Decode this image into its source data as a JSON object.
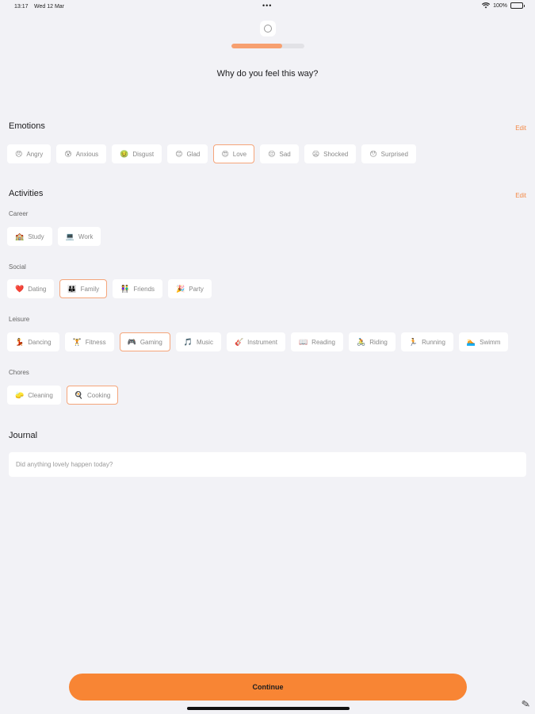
{
  "status_bar": {
    "time": "13:17",
    "date": "Wed 12 Mar",
    "battery": "100%"
  },
  "header": {
    "progress": 0.7,
    "question": "Why do you feel this way?"
  },
  "emotions": {
    "title": "Emotions",
    "edit_label": "Edit",
    "items": [
      {
        "icon": "😠",
        "label": "Angry",
        "selected": false
      },
      {
        "icon": "😰",
        "label": "Anxious",
        "selected": false
      },
      {
        "icon": "🤢",
        "label": "Disgust",
        "selected": false
      },
      {
        "icon": "😊",
        "label": "Glad",
        "selected": false
      },
      {
        "icon": "😍",
        "label": "Love",
        "selected": true
      },
      {
        "icon": "😔",
        "label": "Sad",
        "selected": false
      },
      {
        "icon": "😦",
        "label": "Shocked",
        "selected": false
      },
      {
        "icon": "😯",
        "label": "Surprised",
        "selected": false
      }
    ]
  },
  "activities": {
    "title": "Activities",
    "edit_label": "Edit",
    "groups": [
      {
        "name": "Career",
        "items": [
          {
            "icon": "🏫",
            "label": "Study",
            "selected": false
          },
          {
            "icon": "💻",
            "label": "Work",
            "selected": false
          }
        ]
      },
      {
        "name": "Social",
        "items": [
          {
            "icon": "❤️",
            "label": "Dating",
            "selected": false
          },
          {
            "icon": "👪",
            "label": "Family",
            "selected": true
          },
          {
            "icon": "👫",
            "label": "Friends",
            "selected": false
          },
          {
            "icon": "🎉",
            "label": "Party",
            "selected": false
          }
        ]
      },
      {
        "name": "Leisure",
        "items": [
          {
            "icon": "💃",
            "label": "Dancing",
            "selected": false
          },
          {
            "icon": "🏋",
            "label": "Fitness",
            "selected": false
          },
          {
            "icon": "🎮",
            "label": "Gaming",
            "selected": true
          },
          {
            "icon": "🎵",
            "label": "Music",
            "selected": false
          },
          {
            "icon": "🎸",
            "label": "Instrument",
            "selected": false
          },
          {
            "icon": "📖",
            "label": "Reading",
            "selected": false
          },
          {
            "icon": "🚴",
            "label": "Riding",
            "selected": false
          },
          {
            "icon": "🏃",
            "label": "Running",
            "selected": false
          },
          {
            "icon": "🏊",
            "label": "Swimm",
            "selected": false
          }
        ]
      },
      {
        "name": "Chores",
        "items": [
          {
            "icon": "🧽",
            "label": "Cleaning",
            "selected": false
          },
          {
            "icon": "🍳",
            "label": "Cooking",
            "selected": true
          }
        ]
      }
    ]
  },
  "journal": {
    "title": "Journal",
    "placeholder": "Did anything lovely happen today?"
  },
  "footer": {
    "continue_label": "Continue"
  },
  "colors": {
    "accent": "#f88534",
    "selected_border": "#f5a57a",
    "edit": "#f48a47",
    "background": "#f2f2f6"
  }
}
